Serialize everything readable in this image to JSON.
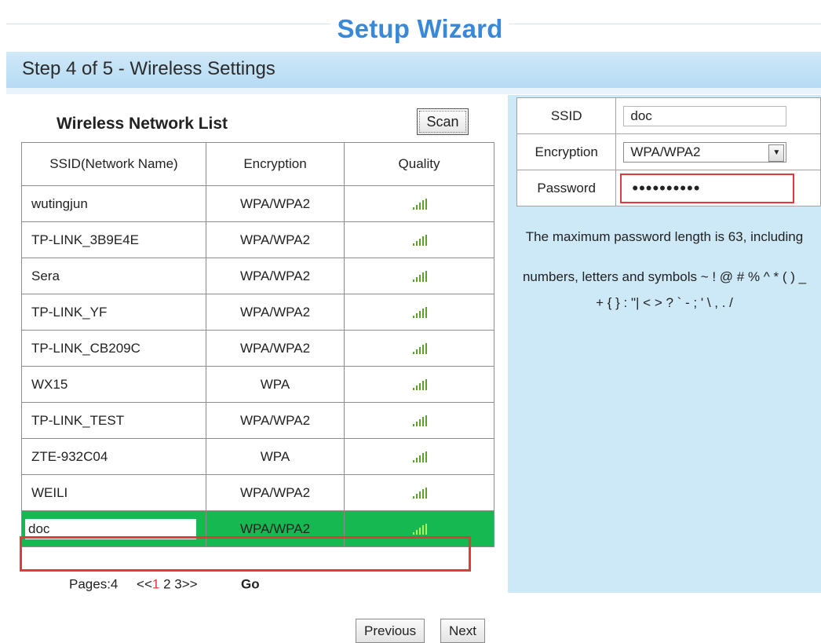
{
  "header": {
    "title": "Setup Wizard",
    "step": "Step 4 of 5 - Wireless Settings"
  },
  "network_list": {
    "title": "Wireless Network List",
    "scan_label": "Scan",
    "columns": [
      "SSID(Network Name)",
      "Encryption",
      "Quality"
    ],
    "rows": [
      {
        "ssid": "wutingjun",
        "encryption": "WPA/WPA2"
      },
      {
        "ssid": "TP-LINK_3B9E4E",
        "encryption": "WPA/WPA2"
      },
      {
        "ssid": "Sera",
        "encryption": "WPA/WPA2"
      },
      {
        "ssid": "TP-LINK_YF",
        "encryption": "WPA/WPA2"
      },
      {
        "ssid": "TP-LINK_CB209C",
        "encryption": "WPA/WPA2"
      },
      {
        "ssid": "WX15",
        "encryption": "WPA"
      },
      {
        "ssid": "TP-LINK_TEST",
        "encryption": "WPA/WPA2"
      },
      {
        "ssid": "ZTE-932C04",
        "encryption": "WPA"
      },
      {
        "ssid": "WEILI",
        "encryption": "WPA/WPA2"
      },
      {
        "ssid": "doc",
        "encryption": "WPA/WPA2",
        "selected": true
      }
    ],
    "quality_icon": "signal-strength-icon",
    "pager": {
      "pages_label": "Pages:4",
      "prev": "<<",
      "current": "1",
      "others": "2 3",
      "next": ">>",
      "go_label": "Go"
    }
  },
  "settings": {
    "ssid_label": "SSID",
    "ssid_value": "doc",
    "encryption_label": "Encryption",
    "encryption_value": "WPA/WPA2",
    "password_label": "Password",
    "password_value": "••••••••••",
    "note_line1": "The maximum password length is 63, including",
    "note_line2": "numbers, letters and symbols ~ ! @ # % ^ * ( ) _",
    "note_line3": "+ { } : \"| < > ? ` - ; ' \\ , . /"
  },
  "nav": {
    "previous_label": "Previous",
    "next_label": "Next"
  },
  "colors": {
    "accent_title": "#3a88d8",
    "selected_row": "#16b851",
    "highlight_border": "#e23a3a",
    "panel_bg": "#cde9f8"
  }
}
